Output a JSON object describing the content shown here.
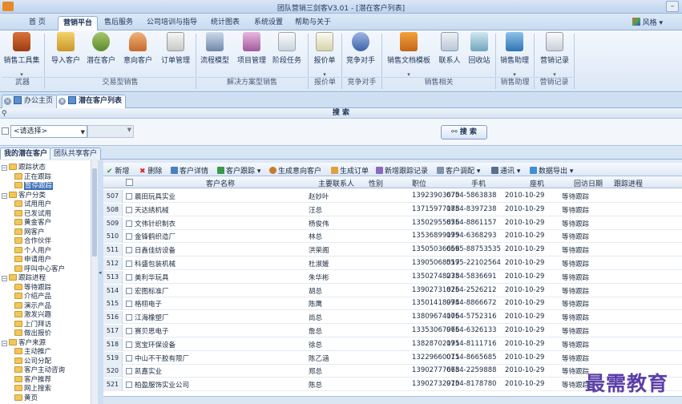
{
  "window": {
    "title": "团队营销三剑客V3.01 - [潜在客户列表]"
  },
  "menu": {
    "tabs": [
      "首 页",
      "营销平台",
      "售后服务",
      "公司培训与指导",
      "统计图表",
      "系统设置",
      "帮助与关于"
    ],
    "style_label": "风格"
  },
  "ribbon": {
    "buttons": [
      "销售工具集",
      "导入客户",
      "潜在客户",
      "意向客户",
      "订单管理",
      "流程模型",
      "项目管理",
      "阶段任务",
      "报价单",
      "竞争对手",
      "销售文档模板",
      "联系人",
      "回收站",
      "销售助理",
      "营销记录"
    ],
    "groups": [
      "武器",
      "交易型销售",
      "解决方案型销售",
      "报价单",
      "竞争对手",
      "销售相关",
      "销售助理",
      "营销记录"
    ]
  },
  "doc_tabs": [
    "办公主页",
    "潜在客户列表"
  ],
  "search": {
    "header": "搜 索",
    "select_placeholder": "<请选择>",
    "button": "搜 索"
  },
  "list_tabs": [
    "我的潜在客户",
    "团队共享客户"
  ],
  "tree": [
    {
      "label": "跟踪状态",
      "level": 0,
      "expanded": true
    },
    {
      "label": "正在跟踪",
      "level": 1
    },
    {
      "label": "暂停跟踪",
      "level": 1,
      "selected": true
    },
    {
      "label": "客户分类",
      "level": 0,
      "expanded": true
    },
    {
      "label": "试用用户",
      "level": 1
    },
    {
      "label": "已发试用",
      "level": 1
    },
    {
      "label": "黄金客户",
      "level": 1
    },
    {
      "label": "网客户",
      "level": 1
    },
    {
      "label": "合作伙伴",
      "level": 1
    },
    {
      "label": "个人用户",
      "level": 1
    },
    {
      "label": "申请用户",
      "level": 1
    },
    {
      "label": "呼叫中心客户",
      "level": 1
    },
    {
      "label": "跟踪进程",
      "level": 0,
      "expanded": true
    },
    {
      "label": "等待跟踪",
      "level": 1
    },
    {
      "label": "介绍产品",
      "level": 1
    },
    {
      "label": "演示产品",
      "level": 1
    },
    {
      "label": "激发兴趣",
      "level": 1
    },
    {
      "label": "上门拜访",
      "level": 1
    },
    {
      "label": "做出报价",
      "level": 1
    },
    {
      "label": "客户来源",
      "level": 0,
      "expanded": true
    },
    {
      "label": "主动推广",
      "level": 1
    },
    {
      "label": "公司分配",
      "level": 1
    },
    {
      "label": "客户主动咨询",
      "level": 1
    },
    {
      "label": "客户推荐",
      "level": 1
    },
    {
      "label": "网上搜索",
      "level": 1
    },
    {
      "label": "黄页",
      "level": 1
    }
  ],
  "toolbar": [
    "新增",
    "删除",
    "客户详情",
    "客户跟踪",
    "生成意向客户",
    "生成订单",
    "新增跟踪记录",
    "客户调配",
    "通讯",
    "数据导出"
  ],
  "grid": {
    "columns": [
      "客户名称",
      "主要联系人",
      "性别",
      "职位",
      "手机",
      "座机",
      "回访日期",
      "跟踪进程"
    ],
    "rows": [
      [
        "507",
        "晨田玩具实业",
        "赵妙叶",
        "",
        "13923903670",
        "0754-5863838",
        "2010-10-29",
        "等待跟踪"
      ],
      [
        "508",
        "天达绣机械",
        "汪总",
        "",
        "13715977188",
        "0754-8397238",
        "2010-10-29",
        "等待跟踪"
      ],
      [
        "509",
        "文伟针织制衣",
        "杨俊伟",
        "",
        "13502955856",
        "0754-8861157",
        "2010-10-29",
        "等待跟踪"
      ],
      [
        "510",
        "金锋鹤织造厂",
        "林总",
        "",
        "13536899199",
        "0754-6368293",
        "2010-10-29",
        "等待跟踪"
      ],
      [
        "511",
        "日鑫佳纺设备",
        "洪荣阁",
        "",
        "13505036666",
        "0595-88753535",
        "2010-10-29",
        "等待跟踪"
      ],
      [
        "512",
        "科盛包装机械",
        "杜淑媛",
        "",
        "13905068517",
        "0595-22102564",
        "2010-10-29",
        "等待跟踪"
      ],
      [
        "513",
        "美利华玩具",
        "朱华彬",
        "",
        "13502748238",
        "0754-5836691",
        "2010-10-29",
        "等待跟踪"
      ],
      [
        "514",
        "宏图标准厂",
        "胡总",
        "",
        "13902731826",
        "0754-2526212",
        "2010-10-29",
        "等待跟踪"
      ],
      [
        "515",
        "格栩电子",
        "陈鹰",
        "",
        "13501418994",
        "0754-8866672",
        "2010-10-29",
        "等待跟踪"
      ],
      [
        "516",
        "江海橡塑厂",
        "尚总",
        "",
        "13809674106",
        "0754-5752316",
        "2010-10-29",
        "等待跟踪"
      ],
      [
        "517",
        "赛贝思电子",
        "詹总",
        "",
        "13353067966",
        "0754-6326133",
        "2010-10-29",
        "等待跟踪"
      ],
      [
        "518",
        "宽宝环保设备",
        "徐总",
        "",
        "13828702191",
        "0754-8111716",
        "2010-10-29",
        "等待跟踪"
      ],
      [
        "519",
        "中山不干胶有限厂",
        "陈乙涵",
        "",
        "13229660011",
        "0754-8665685",
        "2010-10-29",
        "等待跟踪"
      ],
      [
        "520",
        "凯嘉实业",
        "郑总",
        "",
        "13902777668",
        "0754-2259888",
        "2010-10-29",
        "等待跟踪"
      ],
      [
        "521",
        "柏盈服饰实业公司",
        "陈总",
        "",
        "13902732910",
        "0754-8178780",
        "2010-10-29",
        "等待跟踪"
      ]
    ]
  },
  "watermark": "最需教育"
}
